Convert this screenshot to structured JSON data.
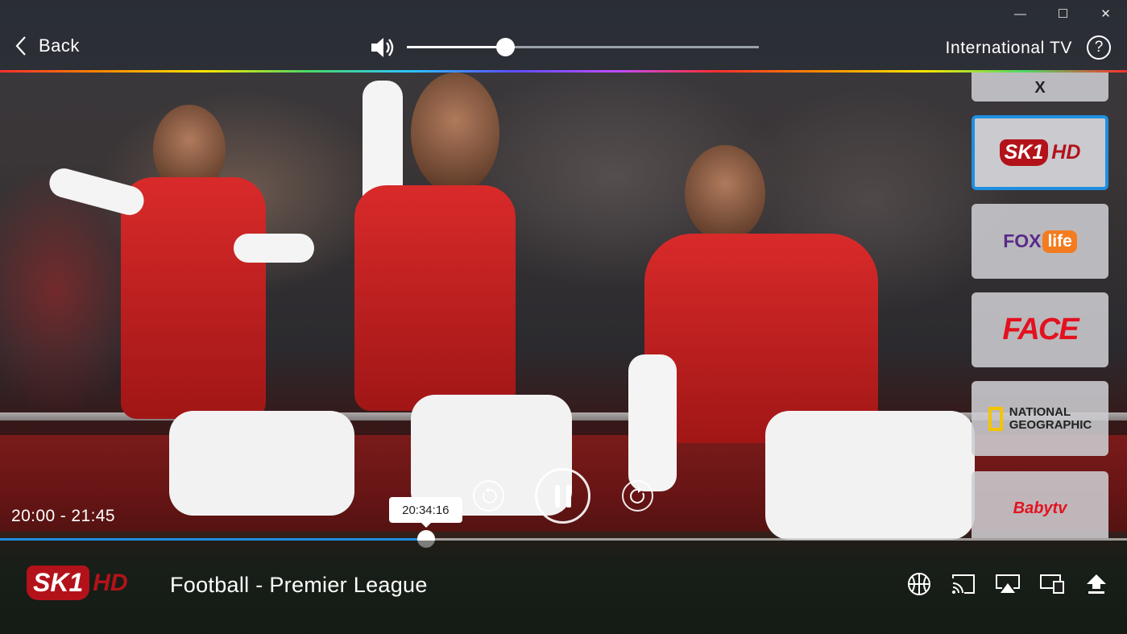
{
  "window": {
    "controls": {
      "minimize": "—",
      "maximize": "☐",
      "close": "✕"
    }
  },
  "header": {
    "back_label": "Back",
    "volume_percent": 28,
    "service_name": "International TV",
    "help_icon": "help-icon"
  },
  "channels": [
    {
      "id": "partial-top",
      "logo_text": "X"
    },
    {
      "id": "sk1hd",
      "logo_badge": "SK1",
      "logo_suffix": "HD",
      "active": true
    },
    {
      "id": "foxlife",
      "logo_main": "FOX",
      "logo_tag": "life"
    },
    {
      "id": "face",
      "logo_text": "FACE"
    },
    {
      "id": "natgeo",
      "logo_line1": "NATIONAL",
      "logo_line2": "GEOGRAPHIC"
    },
    {
      "id": "babytv",
      "logo_text": "Babytv"
    }
  ],
  "playback": {
    "time_range": "20:00 - 21:45",
    "position_tooltip": "20:34:16",
    "progress_percent": 37.8,
    "state": "playing"
  },
  "now_playing": {
    "channel_badge": "SK1",
    "channel_suffix": "HD",
    "program_title": "Football - Premier League"
  },
  "colors": {
    "accent": "#1e8fe0",
    "channel_red": "#b3121a"
  },
  "bottom_icons": [
    "sport-icon",
    "cast-icon",
    "airplay-icon",
    "multiscreen-icon",
    "upload-icon"
  ]
}
